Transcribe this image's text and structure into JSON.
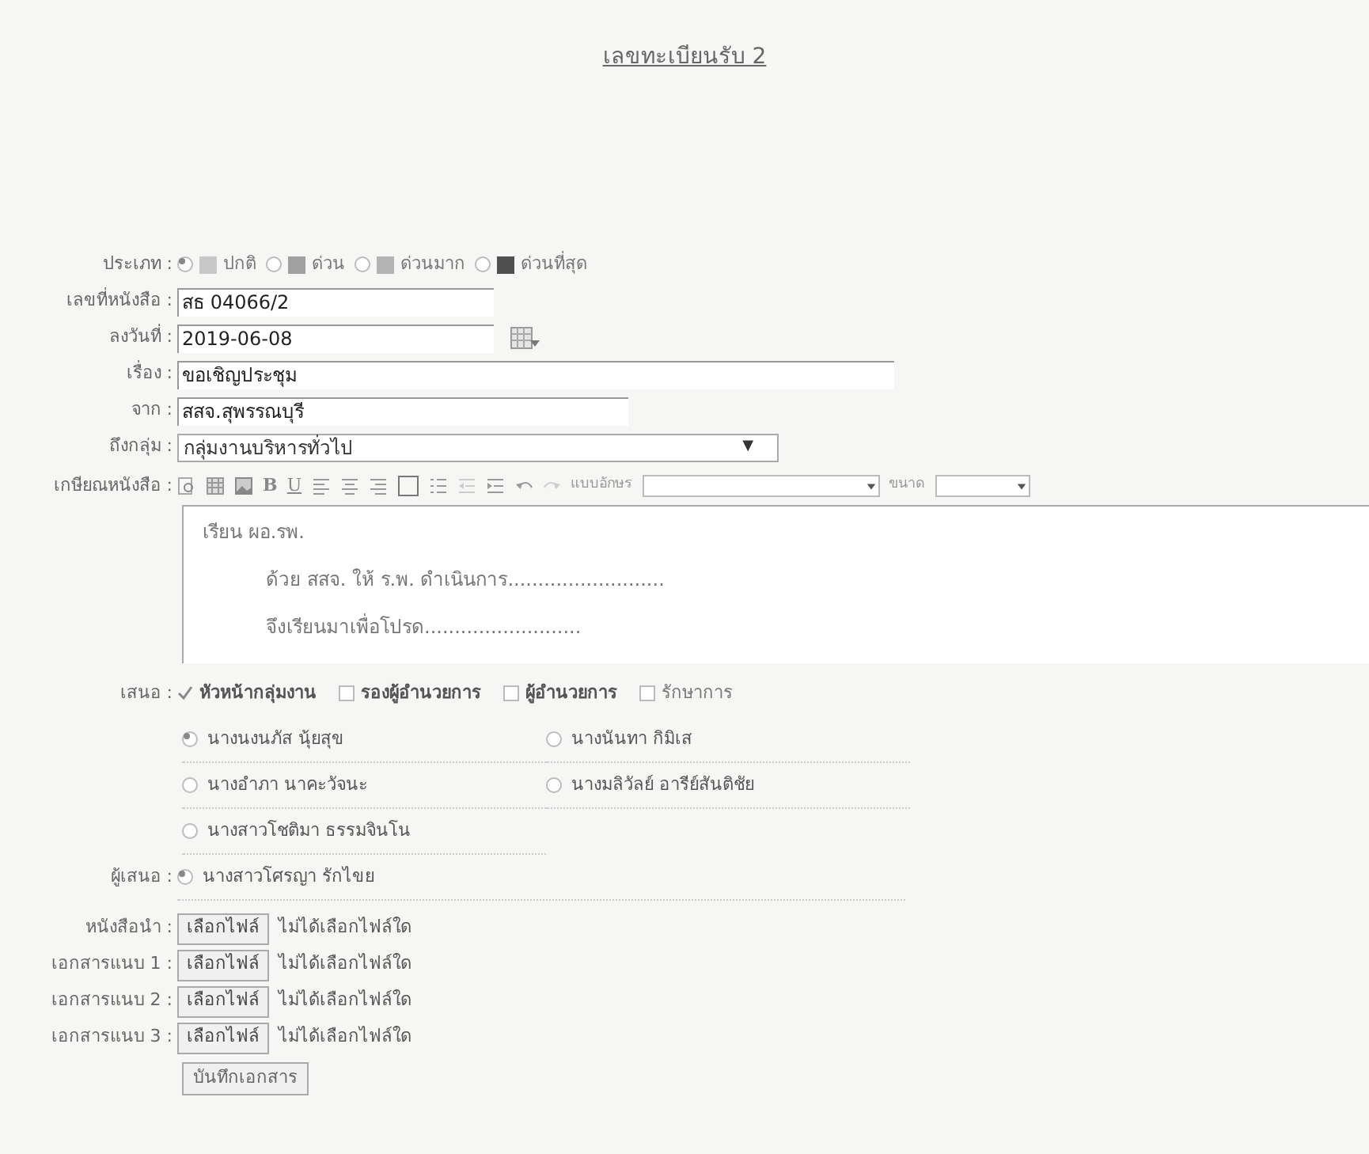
{
  "title": "เลขทะเบียนรับ 2",
  "priority": {
    "label": "ประเภท :",
    "options": [
      {
        "label": "ปกติ",
        "color": "#c8c8c8",
        "selected": true
      },
      {
        "label": "ด่วน",
        "color": "#a0a0a0",
        "selected": false
      },
      {
        "label": "ด่วนมาก",
        "color": "#b4b4b4",
        "selected": false
      },
      {
        "label": "ด่วนที่สุด",
        "color": "#505050",
        "selected": false
      }
    ]
  },
  "fields": [
    {
      "kind": "text",
      "label": "เลขที่หนังสือ :",
      "value": "สธ 04066/2"
    },
    {
      "kind": "date",
      "label": "ลงวันที่ :",
      "value": "2019-06-08"
    },
    {
      "kind": "text",
      "label": "เรื่อง :",
      "value": "ขอเชิญประชุม"
    },
    {
      "kind": "text",
      "label": "จาก :",
      "value": "สสจ.สุพรรณบุรี"
    },
    {
      "kind": "select",
      "label": "ถึงกลุ่ม :",
      "value": "กลุ่มงานบริหารทั่วไป",
      "arrow": "▼"
    }
  ],
  "editor": {
    "label": "เกษียณหนังสือ :",
    "text_buttons": [
      "B",
      "U"
    ],
    "font_label": "แบบอักษร",
    "size_label": "ขนาด",
    "lines": [
      {
        "text": "เรียน  ผอ.รพ.",
        "kind": "salutation"
      },
      {
        "text": "ด้วย สสจ. ให้ ร.พ. ดำเนินการ..........................",
        "kind": "body"
      },
      {
        "text": "จึงเรียนมาเพื่อโปรด..........................",
        "kind": "body"
      }
    ]
  },
  "propose": {
    "label": "เสนอ :",
    "roles": [
      {
        "label": "หัวหน้ากลุ่มงาน",
        "checked": true,
        "kind": "position"
      },
      {
        "label": "รองผู้อำนวยการ",
        "checked": false,
        "kind": "position"
      },
      {
        "label": "ผู้อำนวยการ",
        "checked": false,
        "kind": "position"
      },
      {
        "label": "รักษาการ",
        "checked": false,
        "kind": "acting"
      }
    ],
    "people": [
      {
        "label": "นางนงนภัส นุ้ยสุข",
        "selected": true
      },
      {
        "label": "นางนันทา กิมิเส",
        "selected": false
      },
      {
        "label": "นางอำภา นาคะวัจนะ",
        "selected": false
      },
      {
        "label": "นางมลิวัลย์ อารีย์สันติชัย",
        "selected": false
      },
      {
        "label": "นางสาวโชติมา ธรรมจินโน",
        "selected": false
      }
    ]
  },
  "proposer": {
    "label": "ผู้เสนอ :",
    "name": "นางสาวโศรญา รักไขย",
    "selected": true
  },
  "files": [
    {
      "label": "หนังสือนำ :",
      "button": "เลือกไฟล์",
      "status": "ไม่ได้เลือกไฟล์ใด"
    },
    {
      "label": "เอกสารแนบ 1 :",
      "button": "เลือกไฟล์",
      "status": "ไม่ได้เลือกไฟล์ใด"
    },
    {
      "label": "เอกสารแนบ 2 :",
      "button": "เลือกไฟล์",
      "status": "ไม่ได้เลือกไฟล์ใด"
    },
    {
      "label": "เอกสารแนบ 3 :",
      "button": "เลือกไฟล์",
      "status": "ไม่ได้เลือกไฟล์ใด"
    }
  ],
  "save_button": "บันทึกเอกสาร"
}
